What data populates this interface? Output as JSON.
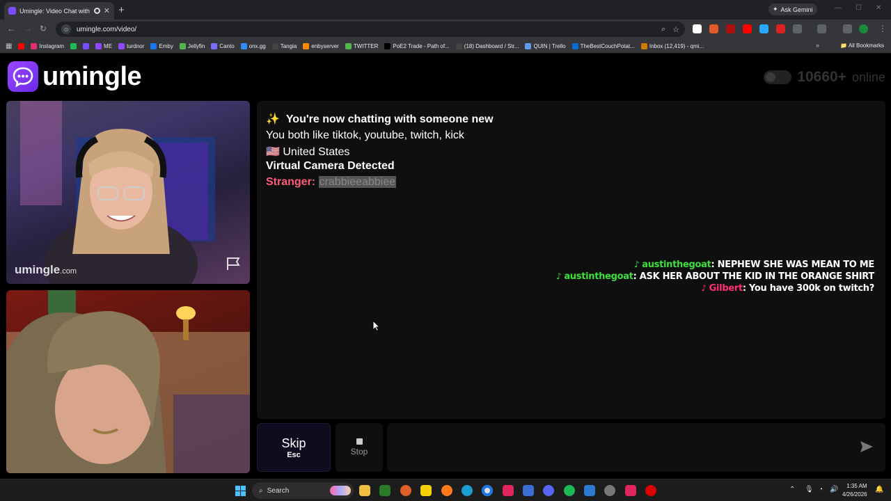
{
  "browser": {
    "tab_title": "Umingle: Video Chat with S",
    "gemini_label": "Ask Gemini",
    "url": "umingle.com/video/",
    "bookmarks": [
      {
        "label": "",
        "color": "#ff0000"
      },
      {
        "label": "Instagram",
        "color": "#e1306c"
      },
      {
        "label": "",
        "color": "#1db954"
      },
      {
        "label": "",
        "color": "#7a4cff"
      },
      {
        "label": "ME",
        "color": "#9146ff"
      },
      {
        "label": "turdnor",
        "color": "#9146ff"
      },
      {
        "label": "Emby",
        "color": "#1877f2"
      },
      {
        "label": "Jellyfin",
        "color": "#52b54b"
      },
      {
        "label": "Canto",
        "color": "#7a6cff"
      },
      {
        "label": "onx.gg",
        "color": "#2f8cff"
      },
      {
        "label": "Tangia",
        "color": "#444"
      },
      {
        "label": "enbyserver",
        "color": "#ff8a00"
      },
      {
        "label": "TWITTER",
        "color": "#52b54b"
      },
      {
        "label": "PoE2 Trade - Path of...",
        "color": "#000"
      },
      {
        "label": "(18) Dashboard / Str...",
        "color": "#444"
      },
      {
        "label": "QUIN | Trello",
        "color": "#5d9cec"
      },
      {
        "label": "TheBestCouchPotat...",
        "color": "#0a6bd6"
      },
      {
        "label": "Inbox (12,419) - qmi...",
        "color": "#cc7a00"
      }
    ],
    "all_bookmarks": "All Bookmarks"
  },
  "site": {
    "logo_text": "umingle",
    "online_count": "10660+",
    "online_label": "online",
    "watermark_main": "umingle",
    "watermark_suffix": ".com"
  },
  "chat": {
    "new_chat_emoji": "✨",
    "new_chat": "You're now chatting with someone new",
    "interests": "You both like tiktok, youtube, twitch, kick",
    "country_flag": "🇺🇸",
    "country": "United States",
    "virtual_camera": "Virtual Camera Detected",
    "stranger_label": "Stranger:",
    "stranger_name": "crabbieeabbiee"
  },
  "overlay_messages": [
    {
      "user": "austinthegoat",
      "text": ": NEPHEW SHE WAS MEAN TO ME",
      "color": "#3ce03c"
    },
    {
      "user": "austinthegoat",
      "text": ": ASK HER ABOUT THE KID IN THE ORANGE SHIRT",
      "color": "#3ce03c"
    },
    {
      "user": "Gilbert",
      "text": ": You have 300k on twitch?",
      "color": "#ff2f77"
    }
  ],
  "controls": {
    "skip_label": "Skip",
    "skip_key": "Esc",
    "stop_label": "Stop",
    "message_placeholder": ""
  },
  "taskbar": {
    "search_label": "Search",
    "time": "1:35 AM",
    "date": "4/26/2026"
  }
}
